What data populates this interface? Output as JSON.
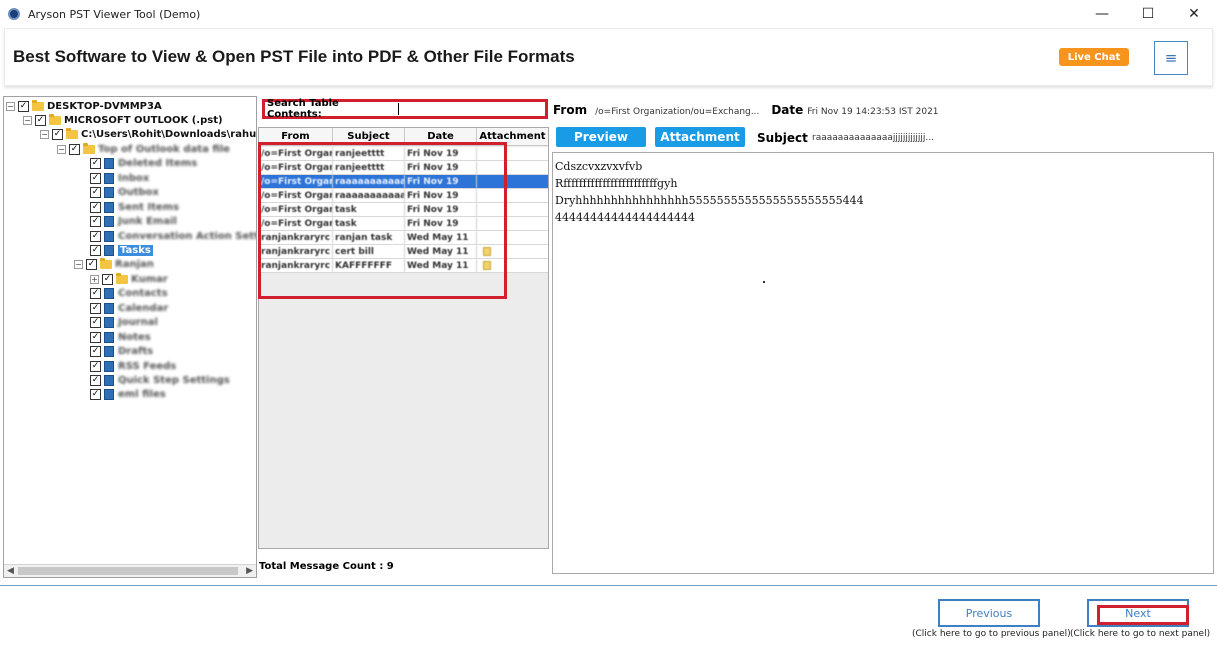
{
  "window": {
    "title": "Aryson PST Viewer Tool (Demo)",
    "minimize": "—",
    "maximize": "☐",
    "close": "✕"
  },
  "header": {
    "title": "Best Software to View & Open PST File into PDF & Other File Formats",
    "live_chat": "Live Chat",
    "menu_icon": "≡"
  },
  "tree": {
    "items": [
      {
        "label": "DESKTOP-DVMMP3A"
      },
      {
        "label": "MICROSOFT OUTLOOK (.pst)"
      },
      {
        "label": "C:\\Users\\Rohit\\Downloads\\rahul"
      },
      {
        "label": "Top of Outlook data file"
      },
      {
        "label": "Deleted Items"
      },
      {
        "label": "Inbox"
      },
      {
        "label": "Outbox"
      },
      {
        "label": "Sent Items"
      },
      {
        "label": "Junk Email"
      },
      {
        "label": "Conversation Action Settings"
      },
      {
        "label": "Tasks"
      },
      {
        "label": "Ranjan"
      },
      {
        "label": "Kumar"
      },
      {
        "label": "Contacts"
      },
      {
        "label": "Calendar"
      },
      {
        "label": "Journal"
      },
      {
        "label": "Notes"
      },
      {
        "label": "Drafts"
      },
      {
        "label": "RSS Feeds"
      },
      {
        "label": "Quick Step Settings"
      },
      {
        "label": "eml files"
      }
    ]
  },
  "search": {
    "label": "Search Table Contents:",
    "value": ""
  },
  "table": {
    "columns": [
      "From",
      "Subject",
      "Date",
      "Attachment"
    ],
    "rows": [
      {
        "from": "/o=First Organ",
        "subject": "ranjeetttt",
        "date": "Fri Nov 19",
        "attachment": ""
      },
      {
        "from": "/o=First Organ",
        "subject": "ranjeetttt",
        "date": "Fri Nov 19",
        "attachment": ""
      },
      {
        "from": "/o=First Organ",
        "subject": "raaaaaaaaaaaaa",
        "date": "Fri Nov 19",
        "attachment": ""
      },
      {
        "from": "/o=First Organ",
        "subject": "raaaaaaaaaaaaa",
        "date": "Fri Nov 19",
        "attachment": ""
      },
      {
        "from": "/o=First Organ",
        "subject": "task",
        "date": "Fri Nov 19",
        "attachment": ""
      },
      {
        "from": "/o=First Organ",
        "subject": "task",
        "date": "Fri Nov 19",
        "attachment": ""
      },
      {
        "from": "ranjankraryrс",
        "subject": "ranjan task",
        "date": "Wed May 11",
        "attachment": ""
      },
      {
        "from": "ranjankraryrс",
        "subject": "cert bill",
        "date": "Wed May 11",
        "attachment": "yes"
      },
      {
        "from": "ranjankraryrс",
        "subject": "KAFFFFFFF",
        "date": "Wed May 11",
        "attachment": "yes"
      }
    ],
    "total_label": "Total Message Count : 9"
  },
  "preview": {
    "from_label": "From",
    "from_value": "/o=First Organization/ou=Exchang...",
    "date_label": "Date",
    "date_value": "Fri Nov 19 14:23:53 IST 2021",
    "preview_tab": "Preview",
    "attachment_tab": "Attachment",
    "subject_label": "Subject",
    "subject_value": "raaaaaaaaaaaaaajjjjjjjjjjjjj...",
    "body_lines": [
      "Cdszcvxzvxvfvb",
      "Rffffffffffffffffffffffffgyh",
      "Dryhhhhhhhhhhhhhhhh5555555555555555555555444",
      "44444444444444444444"
    ]
  },
  "footer": {
    "previous_label": "Previous",
    "previous_hint": "(Click here to go to previous panel)",
    "next_label": "Next",
    "next_hint": "(Click here to go to next panel)"
  },
  "colors": {
    "accent": "#1a9be6",
    "live_chat": "#f7941d",
    "highlight_red": "#d11f2e",
    "selection": "#2d74d8"
  }
}
